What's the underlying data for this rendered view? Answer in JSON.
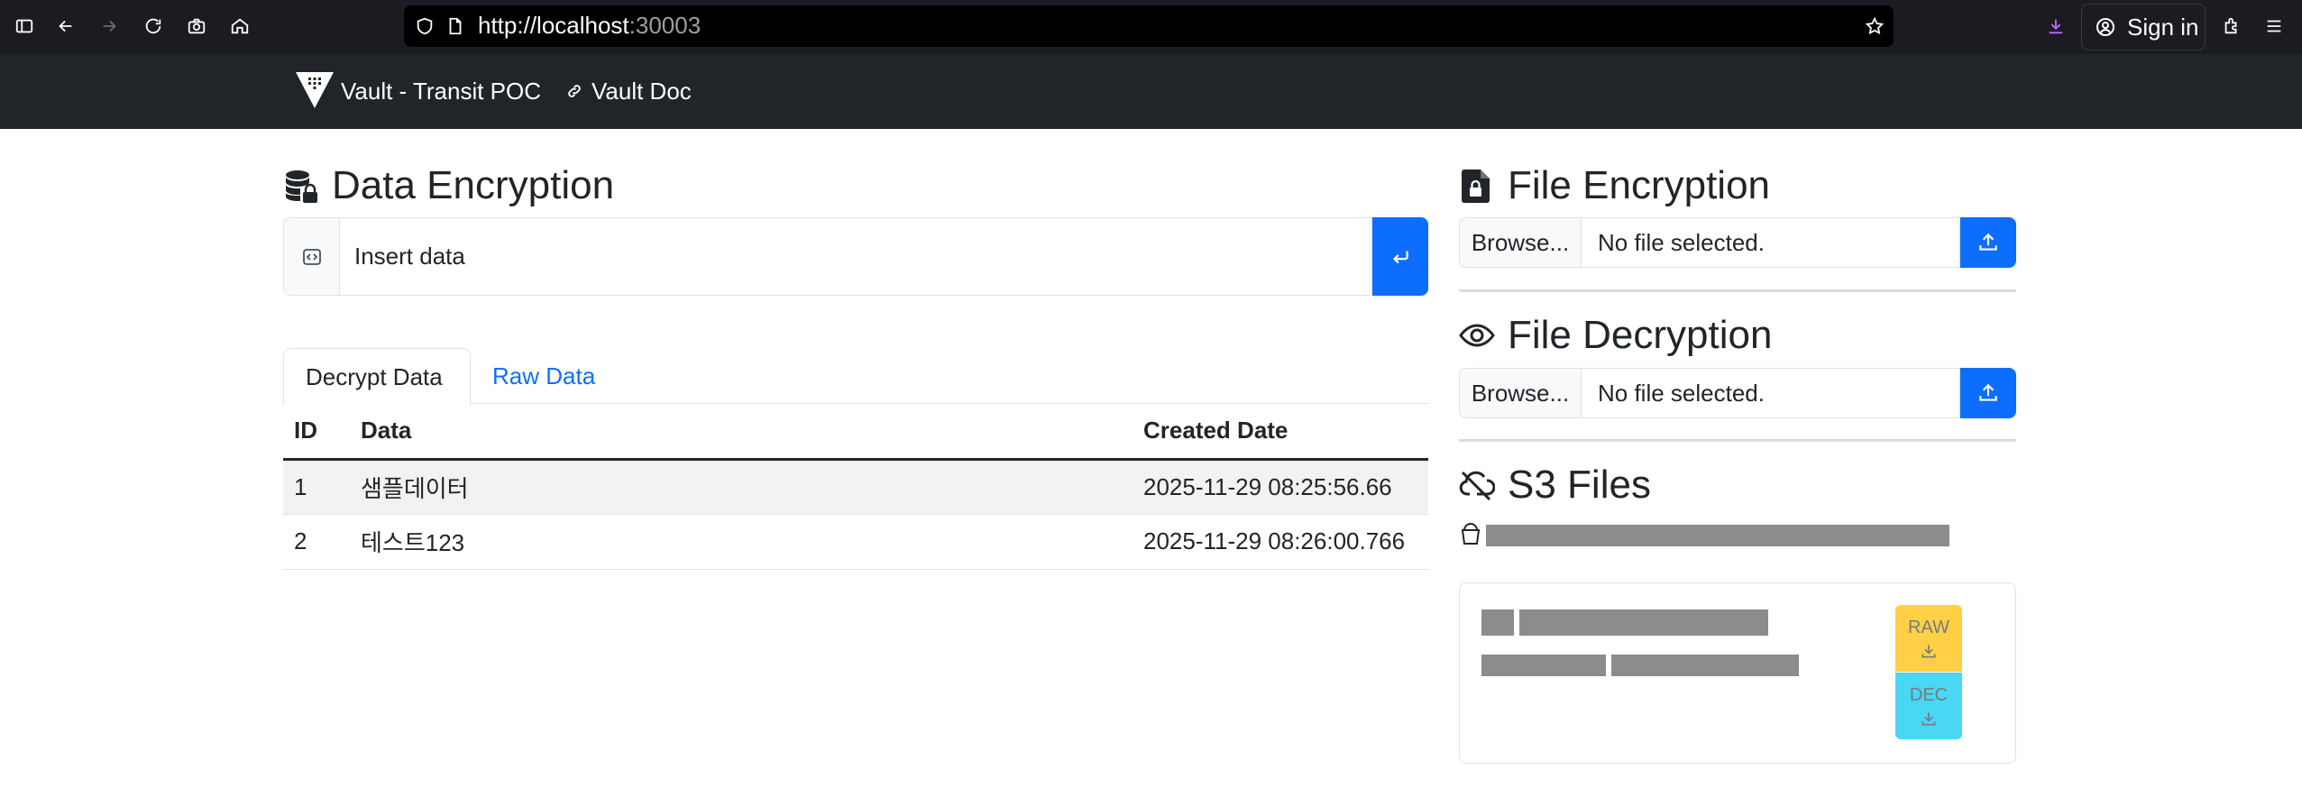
{
  "browser": {
    "url_host": "http://localhost",
    "url_port": ":30003",
    "signin_label": "Sign in"
  },
  "navbar": {
    "brand": "Vault - Transit POC",
    "doc_link": "Vault Doc"
  },
  "data_encryption": {
    "title": "Data Encryption",
    "input_placeholder": "Insert data",
    "tabs": [
      {
        "label": "Decrypt Data",
        "active": true
      },
      {
        "label": "Raw Data",
        "active": false
      }
    ],
    "table": {
      "headers": [
        "ID",
        "Data",
        "Created Date"
      ],
      "rows": [
        {
          "id": "1",
          "data": "샘플데이터",
          "created": "2025-11-29 08:25:56.66"
        },
        {
          "id": "2",
          "data": "테스트123",
          "created": "2025-11-29 08:26:00.766"
        }
      ]
    }
  },
  "file_encryption": {
    "title": "File Encryption",
    "browse_label": "Browse...",
    "file_status": "No file selected."
  },
  "file_decryption": {
    "title": "File Decryption",
    "browse_label": "Browse...",
    "file_status": "No file selected."
  },
  "s3_files": {
    "title": "S3 Files",
    "raw_label": "RAW",
    "dec_label": "DEC"
  },
  "colors": {
    "primary": "#0d6efd",
    "navbar": "#212529",
    "warning": "#ffc107",
    "info": "#0dcaf0"
  }
}
